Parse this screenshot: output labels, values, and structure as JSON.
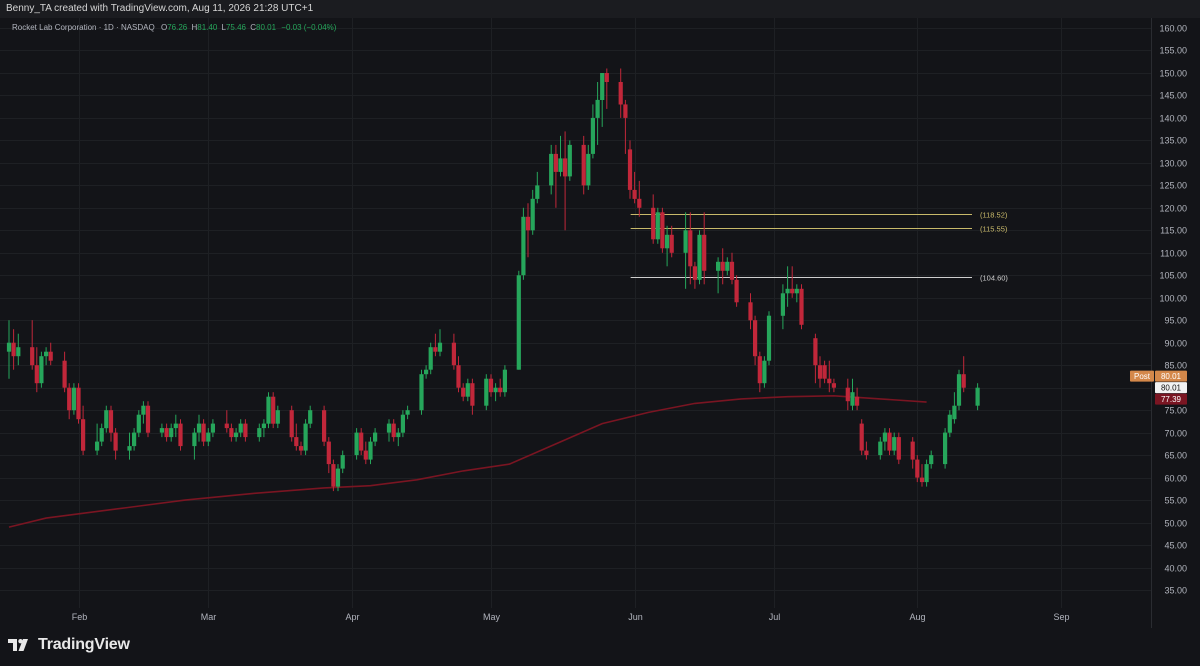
{
  "topbar": {
    "credit": "Benny_TA created with TradingView.com, Aug 11, 2026 21:28 UTC+1"
  },
  "legend": {
    "symbol": "Rocket Lab Corporation · 1D · NASDAQ",
    "o_label": "O",
    "o_value": "76.26",
    "h_label": "H",
    "h_value": "81.40",
    "l_label": "L",
    "l_value": "75.46",
    "c_label": "C",
    "c_value": "80.01",
    "change": "−0.03 (−0.04%)"
  },
  "price_badges": {
    "post_label": "Post",
    "post_value": "80.01",
    "last_value": "80.01",
    "ma_value": "77.39"
  },
  "brand": {
    "name": "TradingView"
  },
  "colors": {
    "up": "#26a65b",
    "down": "#c1273a",
    "ma": "#7a1522",
    "background": "#131418",
    "axis_text": "#b2b5be",
    "grid": "#1e2024",
    "level_yellow": "#c8b96a",
    "level_white": "#cfcfcf",
    "post_badge": "#d4884a"
  },
  "chart_data": {
    "type": "candlestick",
    "ylim": [
      30,
      162
    ],
    "y_ticks": [
      "35.00",
      "40.00",
      "45.00",
      "50.00",
      "55.00",
      "60.00",
      "65.00",
      "70.00",
      "75.00",
      "80.00",
      "85.00",
      "90.00",
      "95.00",
      "100.00",
      "105.00",
      "110.00",
      "115.00",
      "120.00",
      "125.00",
      "130.00",
      "135.00",
      "140.00",
      "145.00",
      "150.00",
      "155.00",
      "160.00"
    ],
    "x_ticks": [
      {
        "label": "Feb",
        "day": 22
      },
      {
        "label": "Mar",
        "day": 50
      },
      {
        "label": "Apr",
        "day": 81
      },
      {
        "label": "May",
        "day": 111
      },
      {
        "label": "Jun",
        "day": 142
      },
      {
        "label": "Jul",
        "day": 172
      },
      {
        "label": "Aug",
        "day": 203
      },
      {
        "label": "Sep",
        "day": 234
      }
    ],
    "x_range": [
      7,
      250
    ],
    "horizontal_levels": [
      {
        "value": 118.52,
        "label": "(118.52)",
        "color": "#c8b96a",
        "start_day": 142
      },
      {
        "value": 115.55,
        "label": "(115.55)",
        "color": "#c8b96a",
        "start_day": 142
      },
      {
        "value": 104.6,
        "label": "(104.60)",
        "color": "#cfcfcf",
        "start_day": 142
      }
    ],
    "moving_average": [
      [
        7,
        49
      ],
      [
        15,
        51
      ],
      [
        30,
        53
      ],
      [
        45,
        55
      ],
      [
        60,
        56.5
      ],
      [
        75,
        57.7
      ],
      [
        85,
        58.2
      ],
      [
        95,
        59.5
      ],
      [
        105,
        61.5
      ],
      [
        115,
        63
      ],
      [
        125,
        67.5
      ],
      [
        135,
        72
      ],
      [
        145,
        74.5
      ],
      [
        155,
        76.5
      ],
      [
        165,
        77.5
      ],
      [
        175,
        78
      ],
      [
        185,
        78.2
      ],
      [
        195,
        77.5
      ],
      [
        205,
        76.8
      ]
    ],
    "candles": [
      {
        "d": 7,
        "o": 88,
        "h": 95,
        "l": 82,
        "c": 90
      },
      {
        "d": 8,
        "o": 90,
        "h": 93,
        "l": 84,
        "c": 87
      },
      {
        "d": 9,
        "o": 87,
        "h": 92,
        "l": 85,
        "c": 89
      },
      {
        "d": 12,
        "o": 89,
        "h": 95,
        "l": 84,
        "c": 85
      },
      {
        "d": 13,
        "o": 85,
        "h": 89,
        "l": 79,
        "c": 81
      },
      {
        "d": 14,
        "o": 81,
        "h": 88,
        "l": 80,
        "c": 87
      },
      {
        "d": 15,
        "o": 87,
        "h": 89,
        "l": 85,
        "c": 88
      },
      {
        "d": 16,
        "o": 88,
        "h": 90,
        "l": 85,
        "c": 86
      },
      {
        "d": 19,
        "o": 86,
        "h": 88,
        "l": 79,
        "c": 80
      },
      {
        "d": 20,
        "o": 80,
        "h": 81,
        "l": 73,
        "c": 75
      },
      {
        "d": 21,
        "o": 75,
        "h": 81,
        "l": 74,
        "c": 80
      },
      {
        "d": 22,
        "o": 80,
        "h": 81,
        "l": 72,
        "c": 73
      },
      {
        "d": 23,
        "o": 73,
        "h": 76,
        "l": 65,
        "c": 66
      },
      {
        "d": 26,
        "o": 66,
        "h": 72,
        "l": 65,
        "c": 68
      },
      {
        "d": 27,
        "o": 68,
        "h": 72,
        "l": 67,
        "c": 71
      },
      {
        "d": 28,
        "o": 71,
        "h": 76,
        "l": 70,
        "c": 75
      },
      {
        "d": 29,
        "o": 75,
        "h": 76,
        "l": 68,
        "c": 70
      },
      {
        "d": 30,
        "o": 70,
        "h": 71,
        "l": 64,
        "c": 66
      },
      {
        "d": 33,
        "o": 66,
        "h": 70,
        "l": 64,
        "c": 67
      },
      {
        "d": 34,
        "o": 67,
        "h": 71,
        "l": 66,
        "c": 70
      },
      {
        "d": 35,
        "o": 70,
        "h": 75,
        "l": 69,
        "c": 74
      },
      {
        "d": 36,
        "o": 74,
        "h": 77,
        "l": 72,
        "c": 76
      },
      {
        "d": 37,
        "o": 76,
        "h": 77,
        "l": 69,
        "c": 70
      },
      {
        "d": 40,
        "o": 70,
        "h": 72,
        "l": 69,
        "c": 71
      },
      {
        "d": 41,
        "o": 71,
        "h": 72,
        "l": 68,
        "c": 69
      },
      {
        "d": 42,
        "o": 69,
        "h": 72,
        "l": 68,
        "c": 71
      },
      {
        "d": 43,
        "o": 71,
        "h": 74,
        "l": 69,
        "c": 72
      },
      {
        "d": 44,
        "o": 72,
        "h": 73,
        "l": 66,
        "c": 67
      },
      {
        "d": 47,
        "o": 67,
        "h": 71,
        "l": 64,
        "c": 70
      },
      {
        "d": 48,
        "o": 70,
        "h": 74,
        "l": 68,
        "c": 72
      },
      {
        "d": 49,
        "o": 72,
        "h": 73,
        "l": 67,
        "c": 68
      },
      {
        "d": 50,
        "o": 68,
        "h": 71,
        "l": 67,
        "c": 70
      },
      {
        "d": 51,
        "o": 70,
        "h": 73,
        "l": 69,
        "c": 72
      },
      {
        "d": 54,
        "o": 72,
        "h": 75,
        "l": 70,
        "c": 71
      },
      {
        "d": 55,
        "o": 71,
        "h": 72,
        "l": 68,
        "c": 69
      },
      {
        "d": 56,
        "o": 69,
        "h": 71,
        "l": 68,
        "c": 70
      },
      {
        "d": 57,
        "o": 70,
        "h": 73,
        "l": 69,
        "c": 72
      },
      {
        "d": 58,
        "o": 72,
        "h": 73,
        "l": 68,
        "c": 69
      },
      {
        "d": 61,
        "o": 69,
        "h": 72,
        "l": 68,
        "c": 71
      },
      {
        "d": 62,
        "o": 71,
        "h": 73,
        "l": 69,
        "c": 72
      },
      {
        "d": 63,
        "o": 72,
        "h": 79,
        "l": 71,
        "c": 78
      },
      {
        "d": 64,
        "o": 78,
        "h": 79,
        "l": 71,
        "c": 72
      },
      {
        "d": 65,
        "o": 72,
        "h": 76,
        "l": 71,
        "c": 75
      },
      {
        "d": 68,
        "o": 75,
        "h": 76,
        "l": 68,
        "c": 69
      },
      {
        "d": 69,
        "o": 69,
        "h": 72,
        "l": 66,
        "c": 67
      },
      {
        "d": 70,
        "o": 67,
        "h": 68,
        "l": 65,
        "c": 66
      },
      {
        "d": 71,
        "o": 66,
        "h": 73,
        "l": 65,
        "c": 72
      },
      {
        "d": 72,
        "o": 72,
        "h": 76,
        "l": 71,
        "c": 75
      },
      {
        "d": 75,
        "o": 75,
        "h": 76,
        "l": 67,
        "c": 68
      },
      {
        "d": 76,
        "o": 68,
        "h": 69,
        "l": 61,
        "c": 63
      },
      {
        "d": 77,
        "o": 63,
        "h": 64,
        "l": 57,
        "c": 58
      },
      {
        "d": 78,
        "o": 58,
        "h": 63,
        "l": 57,
        "c": 62
      },
      {
        "d": 79,
        "o": 62,
        "h": 66,
        "l": 61,
        "c": 65
      },
      {
        "d": 82,
        "o": 65,
        "h": 71,
        "l": 64,
        "c": 70
      },
      {
        "d": 83,
        "o": 70,
        "h": 71,
        "l": 65,
        "c": 66
      },
      {
        "d": 84,
        "o": 66,
        "h": 68,
        "l": 63,
        "c": 64
      },
      {
        "d": 85,
        "o": 64,
        "h": 69,
        "l": 63,
        "c": 68
      },
      {
        "d": 86,
        "o": 68,
        "h": 71,
        "l": 67,
        "c": 70
      },
      {
        "d": 89,
        "o": 70,
        "h": 73,
        "l": 68,
        "c": 72
      },
      {
        "d": 90,
        "o": 72,
        "h": 73,
        "l": 68,
        "c": 69
      },
      {
        "d": 91,
        "o": 69,
        "h": 71,
        "l": 67,
        "c": 70
      },
      {
        "d": 92,
        "o": 70,
        "h": 75,
        "l": 69,
        "c": 74
      },
      {
        "d": 93,
        "o": 74,
        "h": 76,
        "l": 73,
        "c": 75
      },
      {
        "d": 96,
        "o": 75,
        "h": 84,
        "l": 74,
        "c": 83
      },
      {
        "d": 97,
        "o": 83,
        "h": 85,
        "l": 82,
        "c": 84
      },
      {
        "d": 98,
        "o": 84,
        "h": 90,
        "l": 83,
        "c": 89
      },
      {
        "d": 99,
        "o": 89,
        "h": 92,
        "l": 87,
        "c": 88
      },
      {
        "d": 100,
        "o": 88,
        "h": 93,
        "l": 87,
        "c": 90
      },
      {
        "d": 103,
        "o": 90,
        "h": 92,
        "l": 84,
        "c": 85
      },
      {
        "d": 104,
        "o": 85,
        "h": 87,
        "l": 79,
        "c": 80
      },
      {
        "d": 105,
        "o": 80,
        "h": 81,
        "l": 77,
        "c": 78
      },
      {
        "d": 106,
        "o": 78,
        "h": 82,
        "l": 77,
        "c": 81
      },
      {
        "d": 107,
        "o": 81,
        "h": 82,
        "l": 74,
        "c": 76
      },
      {
        "d": 110,
        "o": 76,
        "h": 83,
        "l": 75,
        "c": 82
      },
      {
        "d": 111,
        "o": 82,
        "h": 83,
        "l": 78,
        "c": 79
      },
      {
        "d": 112,
        "o": 79,
        "h": 81,
        "l": 77,
        "c": 80
      },
      {
        "d": 113,
        "o": 80,
        "h": 82,
        "l": 78,
        "c": 79
      },
      {
        "d": 114,
        "o": 79,
        "h": 85,
        "l": 78,
        "c": 84
      },
      {
        "d": 117,
        "o": 84,
        "h": 106,
        "l": 84,
        "c": 105
      },
      {
        "d": 118,
        "o": 105,
        "h": 120,
        "l": 104,
        "c": 118
      },
      {
        "d": 119,
        "o": 118,
        "h": 121,
        "l": 109,
        "c": 115
      },
      {
        "d": 120,
        "o": 115,
        "h": 124,
        "l": 114,
        "c": 122
      },
      {
        "d": 121,
        "o": 122,
        "h": 128,
        "l": 121,
        "c": 125
      },
      {
        "d": 124,
        "o": 125,
        "h": 134,
        "l": 123,
        "c": 132
      },
      {
        "d": 125,
        "o": 132,
        "h": 134,
        "l": 120,
        "c": 128
      },
      {
        "d": 126,
        "o": 128,
        "h": 136,
        "l": 127,
        "c": 131
      },
      {
        "d": 127,
        "o": 131,
        "h": 137,
        "l": 115,
        "c": 127
      },
      {
        "d": 128,
        "o": 127,
        "h": 135,
        "l": 126,
        "c": 134
      },
      {
        "d": 131,
        "o": 134,
        "h": 136,
        "l": 123,
        "c": 125
      },
      {
        "d": 132,
        "o": 125,
        "h": 134,
        "l": 124,
        "c": 132
      },
      {
        "d": 133,
        "o": 132,
        "h": 143,
        "l": 131,
        "c": 140
      },
      {
        "d": 134,
        "o": 140,
        "h": 148,
        "l": 134,
        "c": 144
      },
      {
        "d": 135,
        "o": 144,
        "h": 150,
        "l": 138,
        "c": 150
      },
      {
        "d": 136,
        "o": 150,
        "h": 151,
        "l": 142,
        "c": 148
      },
      {
        "d": 139,
        "o": 148,
        "h": 151,
        "l": 140,
        "c": 143
      },
      {
        "d": 140,
        "o": 143,
        "h": 144,
        "l": 132,
        "c": 140
      },
      {
        "d": 141,
        "o": 133,
        "h": 135,
        "l": 122,
        "c": 124
      },
      {
        "d": 142,
        "o": 124,
        "h": 128,
        "l": 121,
        "c": 122
      },
      {
        "d": 143,
        "o": 122,
        "h": 126,
        "l": 118,
        "c": 120
      },
      {
        "d": 146,
        "o": 120,
        "h": 123,
        "l": 112,
        "c": 113
      },
      {
        "d": 147,
        "o": 113,
        "h": 120,
        "l": 112,
        "c": 119
      },
      {
        "d": 148,
        "o": 119,
        "h": 120,
        "l": 110,
        "c": 111
      },
      {
        "d": 149,
        "o": 111,
        "h": 116,
        "l": 107,
        "c": 114
      },
      {
        "d": 150,
        "o": 114,
        "h": 116,
        "l": 109,
        "c": 110
      },
      {
        "d": 153,
        "o": 110,
        "h": 119,
        "l": 102,
        "c": 115
      },
      {
        "d": 154,
        "o": 115,
        "h": 119,
        "l": 103,
        "c": 107
      },
      {
        "d": 155,
        "o": 107,
        "h": 108,
        "l": 102,
        "c": 104
      },
      {
        "d": 156,
        "o": 104,
        "h": 115,
        "l": 103,
        "c": 114
      },
      {
        "d": 157,
        "o": 114,
        "h": 119,
        "l": 103,
        "c": 106
      },
      {
        "d": 160,
        "o": 106,
        "h": 109,
        "l": 101,
        "c": 108
      },
      {
        "d": 161,
        "o": 108,
        "h": 111,
        "l": 103,
        "c": 106
      },
      {
        "d": 162,
        "o": 106,
        "h": 109,
        "l": 105,
        "c": 108
      },
      {
        "d": 163,
        "o": 108,
        "h": 110,
        "l": 103,
        "c": 104
      },
      {
        "d": 164,
        "o": 104,
        "h": 105,
        "l": 98,
        "c": 99
      },
      {
        "d": 167,
        "o": 99,
        "h": 101,
        "l": 93,
        "c": 95
      },
      {
        "d": 168,
        "o": 95,
        "h": 96,
        "l": 85,
        "c": 87
      },
      {
        "d": 169,
        "o": 87,
        "h": 88,
        "l": 79,
        "c": 81
      },
      {
        "d": 170,
        "o": 81,
        "h": 87,
        "l": 80,
        "c": 86
      },
      {
        "d": 171,
        "o": 86,
        "h": 97,
        "l": 85,
        "c": 96
      },
      {
        "d": 174,
        "o": 96,
        "h": 103,
        "l": 93,
        "c": 101
      },
      {
        "d": 175,
        "o": 101,
        "h": 107,
        "l": 98,
        "c": 102
      },
      {
        "d": 176,
        "o": 102,
        "h": 107,
        "l": 100,
        "c": 101
      },
      {
        "d": 177,
        "o": 101,
        "h": 103,
        "l": 99,
        "c": 102
      },
      {
        "d": 178,
        "o": 102,
        "h": 103,
        "l": 93,
        "c": 94
      },
      {
        "d": 181,
        "o": 91,
        "h": 92,
        "l": 81,
        "c": 85
      },
      {
        "d": 182,
        "o": 85,
        "h": 87,
        "l": 80,
        "c": 82
      },
      {
        "d": 183,
        "o": 85,
        "h": 86,
        "l": 81,
        "c": 82
      },
      {
        "d": 184,
        "o": 82,
        "h": 86,
        "l": 79,
        "c": 81
      },
      {
        "d": 185,
        "o": 81,
        "h": 82,
        "l": 79,
        "c": 80
      },
      {
        "d": 188,
        "o": 80,
        "h": 82,
        "l": 75,
        "c": 77
      },
      {
        "d": 189,
        "o": 76,
        "h": 82,
        "l": 75,
        "c": 79
      },
      {
        "d": 190,
        "o": 78,
        "h": 80,
        "l": 75,
        "c": 76
      },
      {
        "d": 191,
        "o": 72,
        "h": 73,
        "l": 65,
        "c": 66
      },
      {
        "d": 192,
        "o": 66,
        "h": 68,
        "l": 64,
        "c": 65
      },
      {
        "d": 195,
        "o": 65,
        "h": 69,
        "l": 64,
        "c": 68
      },
      {
        "d": 196,
        "o": 68,
        "h": 71,
        "l": 66,
        "c": 70
      },
      {
        "d": 197,
        "o": 70,
        "h": 71,
        "l": 65,
        "c": 66
      },
      {
        "d": 198,
        "o": 66,
        "h": 70,
        "l": 65,
        "c": 69
      },
      {
        "d": 199,
        "o": 69,
        "h": 70,
        "l": 63,
        "c": 64
      },
      {
        "d": 202,
        "o": 68,
        "h": 69,
        "l": 62,
        "c": 64
      },
      {
        "d": 203,
        "o": 64,
        "h": 65,
        "l": 59,
        "c": 60
      },
      {
        "d": 204,
        "o": 60,
        "h": 63,
        "l": 58,
        "c": 59
      },
      {
        "d": 205,
        "o": 59,
        "h": 64,
        "l": 58,
        "c": 63
      },
      {
        "d": 206,
        "o": 63,
        "h": 66,
        "l": 62,
        "c": 65
      },
      {
        "d": 209,
        "o": 63,
        "h": 71,
        "l": 62,
        "c": 70
      },
      {
        "d": 210,
        "o": 70,
        "h": 75,
        "l": 69,
        "c": 74
      },
      {
        "d": 211,
        "o": 73,
        "h": 79,
        "l": 72,
        "c": 76
      },
      {
        "d": 212,
        "o": 76,
        "h": 84,
        "l": 75,
        "c": 83
      },
      {
        "d": 213,
        "o": 83,
        "h": 87,
        "l": 79,
        "c": 80
      },
      {
        "d": 216,
        "o": 76,
        "h": 81,
        "l": 75,
        "c": 80
      }
    ]
  }
}
